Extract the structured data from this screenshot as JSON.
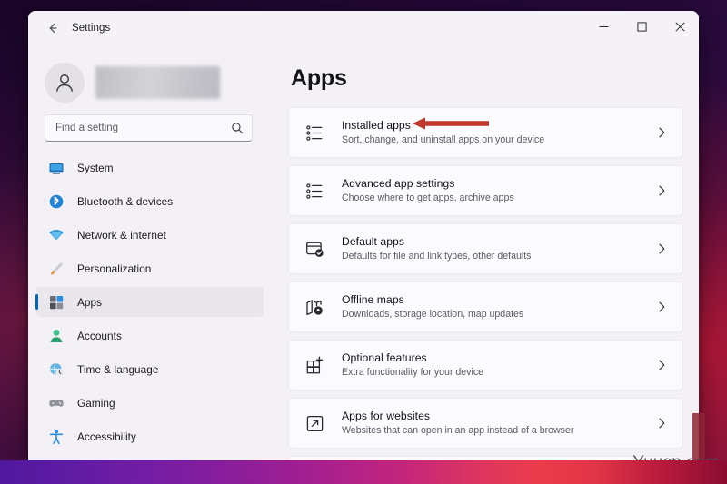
{
  "window": {
    "title": "Settings",
    "back_icon": "back-arrow-icon",
    "controls": {
      "minimize": "–",
      "maximize": "□",
      "close": "✕"
    }
  },
  "sidebar": {
    "profile": {
      "avatar_icon": "user-avatar-icon",
      "name": ""
    },
    "search": {
      "placeholder": "Find a setting",
      "value": "",
      "icon": "search-icon"
    },
    "items": [
      {
        "label": "System",
        "icon": "monitor-icon",
        "active": false
      },
      {
        "label": "Bluetooth & devices",
        "icon": "bluetooth-icon",
        "active": false
      },
      {
        "label": "Network & internet",
        "icon": "wifi-icon",
        "active": false
      },
      {
        "label": "Personalization",
        "icon": "paintbrush-icon",
        "active": false
      },
      {
        "label": "Apps",
        "icon": "apps-grid-icon",
        "active": true
      },
      {
        "label": "Accounts",
        "icon": "person-icon",
        "active": false
      },
      {
        "label": "Time & language",
        "icon": "globe-clock-icon",
        "active": false
      },
      {
        "label": "Gaming",
        "icon": "gamepad-icon",
        "active": false
      },
      {
        "label": "Accessibility",
        "icon": "accessibility-icon",
        "active": false
      }
    ]
  },
  "main": {
    "page_title": "Apps",
    "chevron_icon": "chevron-right-icon",
    "rows": [
      {
        "title": "Installed apps",
        "subtitle": "Sort, change, and uninstall apps on your device",
        "icon": "list-settings-icon",
        "annotated": true
      },
      {
        "title": "Advanced app settings",
        "subtitle": "Choose where to get apps, archive apps",
        "icon": "list-settings-icon",
        "annotated": false
      },
      {
        "title": "Default apps",
        "subtitle": "Defaults for file and link types, other defaults",
        "icon": "window-check-icon",
        "annotated": false
      },
      {
        "title": "Offline maps",
        "subtitle": "Downloads, storage location, map updates",
        "icon": "map-pin-icon",
        "annotated": false
      },
      {
        "title": "Optional features",
        "subtitle": "Extra functionality for your device",
        "icon": "grid-plus-icon",
        "annotated": false
      },
      {
        "title": "Apps for websites",
        "subtitle": "Websites that can open in an app instead of a browser",
        "icon": "external-link-icon",
        "annotated": false
      }
    ]
  },
  "annotation": {
    "type": "arrow-left",
    "color": "#c0392b",
    "points_to": "Installed apps"
  },
  "watermark": {
    "text": "Yuucn.com"
  },
  "colors": {
    "accent": "#0067c0",
    "window_bg": "#f3f0f6",
    "card_bg": "#fbfafc",
    "annotation_red": "#c0392b"
  }
}
